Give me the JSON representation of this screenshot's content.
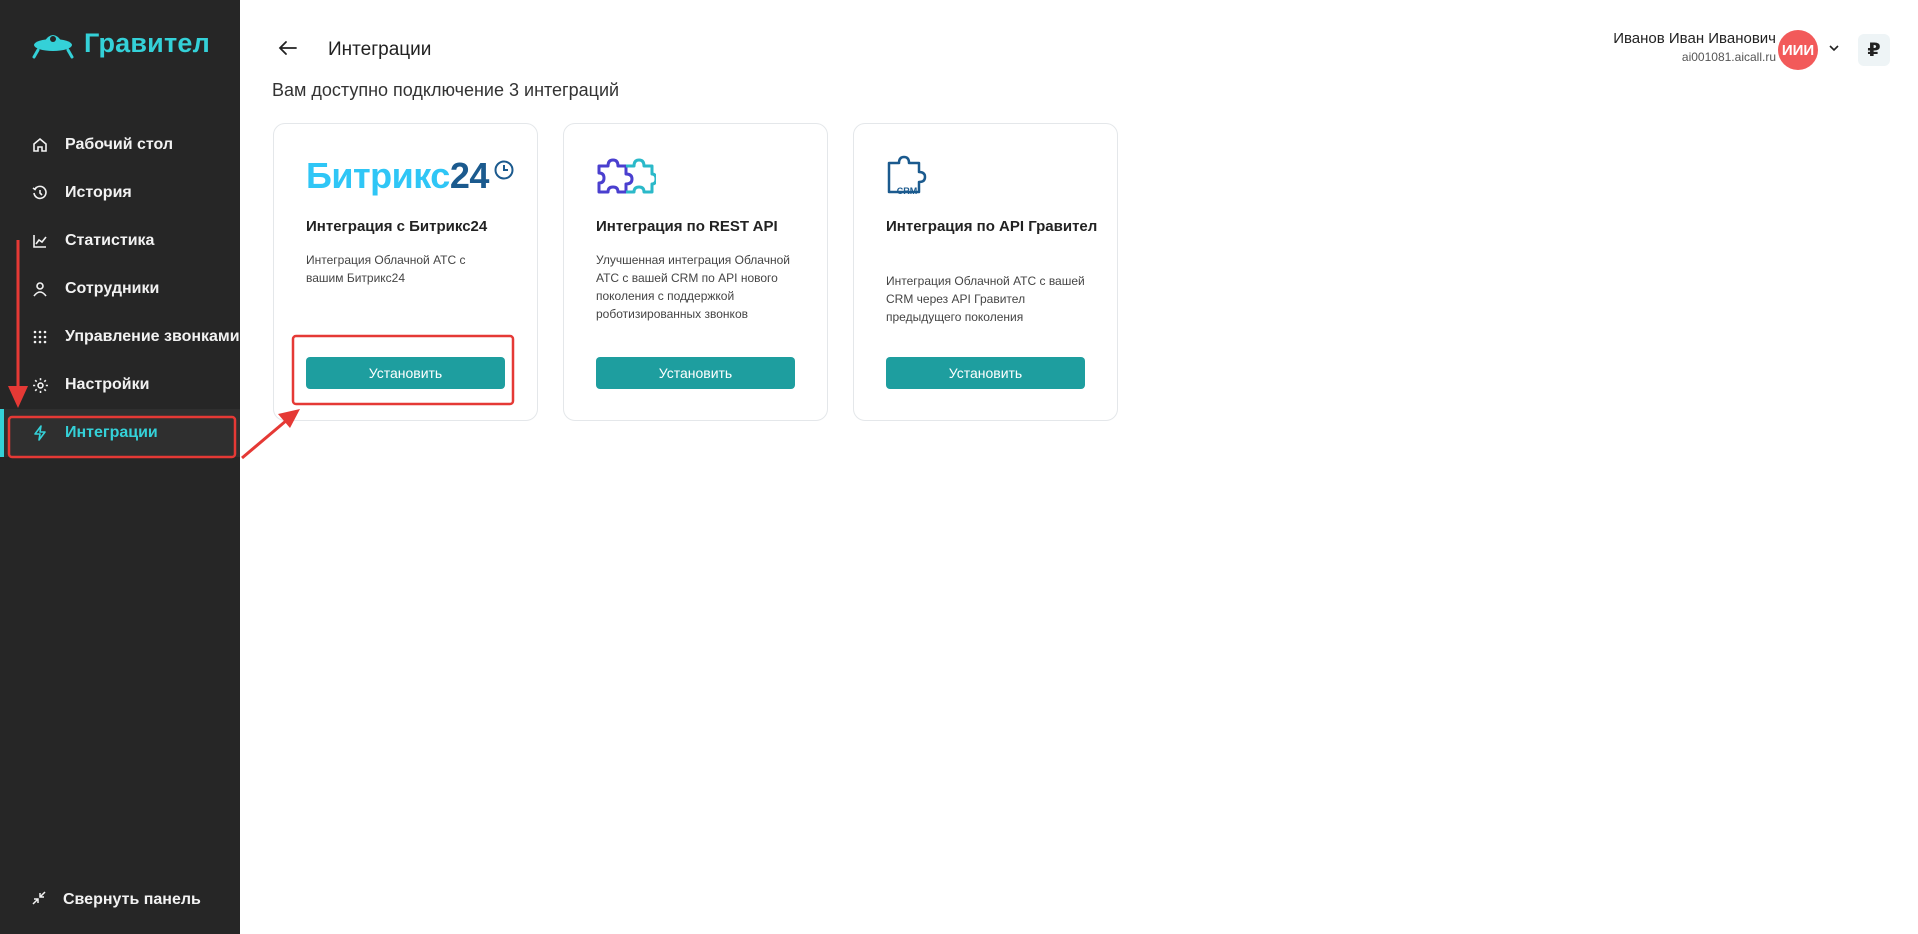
{
  "brand": {
    "name": "Гравител",
    "accent": "#34d1d8"
  },
  "sidebar": {
    "items": [
      {
        "label": "Рабочий стол",
        "icon": "home-icon"
      },
      {
        "label": "История",
        "icon": "history-icon"
      },
      {
        "label": "Статистика",
        "icon": "chart-icon"
      },
      {
        "label": "Сотрудники",
        "icon": "user-icon"
      },
      {
        "label": "Управление звонками",
        "icon": "dialpad-icon"
      },
      {
        "label": "Настройки",
        "icon": "gear-icon"
      },
      {
        "label": "Интеграции",
        "icon": "lightning-icon",
        "active": true
      }
    ],
    "collapse_label": "Свернуть панель"
  },
  "header": {
    "title": "Интеграции",
    "subtitle": "Вам доступно подключение 3 интеграций"
  },
  "user": {
    "name": "Иванов Иван Иванович",
    "domain": "ai001081.aicall.ru",
    "initials": "ИИИ",
    "currency_symbol": "₽"
  },
  "cards": [
    {
      "logo_part1": "Битрикс",
      "logo_part2": "24",
      "title": "Интеграция с Битрикс24",
      "description": "Интеграция Облачной АТС с вашим Битрикс24",
      "button": "Установить"
    },
    {
      "title": "Интеграция по REST API",
      "description": "Улучшенная интеграция Облачной АТС с вашей CRM по API нового поколения с поддержкой роботизированных звонков",
      "button": "Установить"
    },
    {
      "logo_label": "CRM",
      "title": "Интеграция по API Гравител",
      "description": "Интеграция Облачной АТС с вашей CRM через API Гравител предыдущего поколения",
      "button": "Установить"
    }
  ],
  "colors": {
    "sidebar_bg": "#262626",
    "button": "#1e9e9f",
    "avatar": "#f25a5a",
    "annotation": "#e53935"
  }
}
